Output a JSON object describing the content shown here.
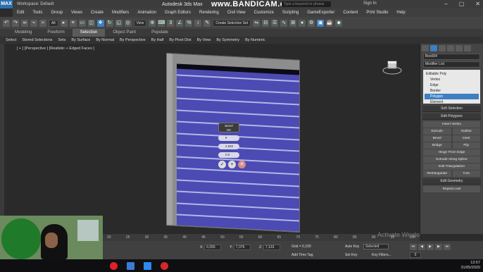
{
  "titlebar": {
    "logo": "MAX",
    "workspace": "Workspace: Default",
    "app_title": "Autodesk 3ds Max",
    "watermark": "www.BANDICAM.com",
    "search_placeholder": "Type a keyword or phrase",
    "signin": "Sign In"
  },
  "menu": [
    "Edit",
    "Tools",
    "Group",
    "Views",
    "Create",
    "Modifiers",
    "Animation",
    "Graph Editors",
    "Rendering",
    "Civil View",
    "Customize",
    "Scripting",
    "GameExporter",
    "Content",
    "Print Studio",
    "Help"
  ],
  "toolbar": {
    "filter_value": "All",
    "coord_value": "View",
    "selection_set_value": "Create Selection Set"
  },
  "ribbon_tabs": [
    "Modeling",
    "Freeform",
    "Selection",
    "Object Paint",
    "Populate"
  ],
  "ribbon_active": "Selection",
  "subbar": [
    "Select",
    "Stored Selections",
    "Sets",
    "By Surface",
    "By Normal",
    "By Perspective",
    "By Half",
    "By Pivot Dist",
    "By View",
    "By Symmetry",
    "By Numeric"
  ],
  "viewport": {
    "label": "[ + ] [Perspective ] [Realistic + Edged Faces ]"
  },
  "caddy": {
    "title_line1": "Bevel",
    "title_line2": "OK",
    "height_value": "2,582",
    "outline_value": "0,0"
  },
  "command_panel": {
    "object_name": "Box004",
    "modifier_list": "Modifier List",
    "stack": [
      {
        "label": "Editable Poly",
        "level": "top"
      },
      {
        "label": "Vertex",
        "level": "sub"
      },
      {
        "label": "Edge",
        "level": "sub"
      },
      {
        "label": "Border",
        "level": "sub"
      },
      {
        "label": "Polygon",
        "level": "sub",
        "selected": true
      },
      {
        "label": "Element",
        "level": "sub"
      }
    ],
    "rollouts": {
      "soft_selection": "Soft Selection",
      "edit_polygons": "Edit Polygons",
      "insert_vertex": "Insert Vertex",
      "extrude": "Extrude",
      "outline": "Outline",
      "bevel": "Bevel",
      "inset": "Inset",
      "bridge": "Bridge",
      "flip": "Flip",
      "hinge": "Hinge From Edge",
      "extrude_spline": "Extrude Along Spline",
      "edit_triangulation": "Edit Triangulation",
      "retriangulate": "Retriangulate",
      "turn": "Turn",
      "edit_geometry": "Edit Geometry",
      "repeat_last": "Repeat Last"
    }
  },
  "timeline_ticks": [
    "20",
    "25",
    "30",
    "35",
    "40",
    "45",
    "50",
    "55",
    "60",
    "65",
    "70",
    "75",
    "80",
    "85",
    "90",
    "95",
    "100"
  ],
  "status": {
    "x_label": "X:",
    "x_value": "0,355",
    "y_label": "Y:",
    "y_value": "7,376",
    "z_label": "Z:",
    "z_value": "7,133",
    "grid": "Grid = 0,100",
    "add_time_tag": "Add Time Tag",
    "auto_key": "Auto Key",
    "set_key": "Set Key",
    "selected": "Selected",
    "key_filters": "Key Filters...",
    "frame": "0"
  },
  "activate": "Activate Windo",
  "tray": {
    "time": "13:57",
    "date": "31/05/2020"
  },
  "colors": {
    "door": "#4b4bb3",
    "accent": "#3d7fc1",
    "viewport_bg": "#2a2a2a"
  }
}
